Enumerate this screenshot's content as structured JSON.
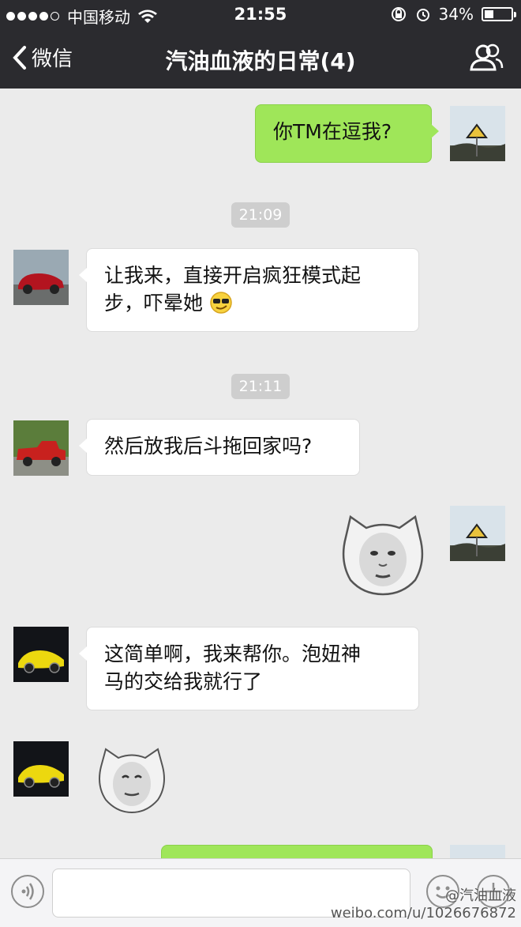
{
  "status_bar": {
    "carrier": "中国移动",
    "time": "21:55",
    "battery": "34%",
    "battery_level": 0.34
  },
  "nav": {
    "back_label": "微信",
    "title": "汽油血液的日常(4)"
  },
  "messages": [
    {
      "side": "right",
      "text": "你TM在逗我?"
    },
    {
      "timestamp": "21:09"
    },
    {
      "side": "left",
      "line1": "让我来，直接开启疯狂模式起",
      "line2": "步，吓晕她"
    },
    {
      "timestamp": "21:11"
    },
    {
      "side": "left",
      "text": "然后放我后斗拖回家吗?"
    },
    {
      "side": "right",
      "sticker": "meme-face-sticker"
    },
    {
      "side": "left",
      "line1": "这简单啊，我来帮你。泡妞神",
      "line2": "马的交给我就行了"
    },
    {
      "side": "left",
      "sticker": "meme-face-sticker"
    }
  ],
  "input": {
    "placeholder": ""
  },
  "watermark": {
    "line1": "@汽油血液",
    "line2": "weibo.com/u/1026676872"
  },
  "colors": {
    "topbar": "#2b2b2f",
    "self_bubble": "#9fe659",
    "other_bubble": "#ffffff",
    "chat_bg": "#ebebeb"
  }
}
